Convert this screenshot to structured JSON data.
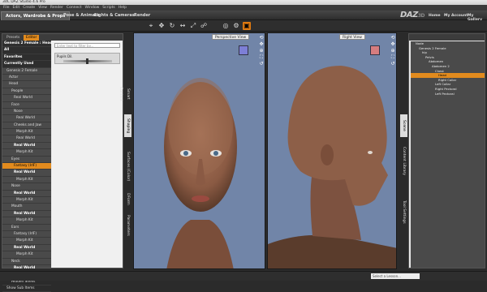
{
  "window": {
    "title": "3dC DAZ Studio 4.6 Pro"
  },
  "menu": [
    "File",
    "Edit",
    "Create",
    "View",
    "Render",
    "Connect",
    "Window",
    "Scripts",
    "Help"
  ],
  "main_tabs": [
    "Actors, Wardrobe & Props",
    "Pose & Animate",
    "Lights & Cameras",
    "Render"
  ],
  "brand": {
    "logo": "DAZ",
    "logo_suffix": "3D"
  },
  "top_links": [
    "Home",
    "My Account",
    "My Gallery"
  ],
  "left_panel": {
    "tabs": [
      "Presets",
      "Editor"
    ],
    "tree": [
      {
        "label": "Genesis 2 Female : Head",
        "style": "hdr"
      },
      {
        "label": "All",
        "style": "hdr"
      },
      {
        "label": "Favorites",
        "style": "hdr"
      },
      {
        "label": "Currently Used",
        "style": "hdr"
      },
      {
        "label": "Genesis 2 Female"
      },
      {
        "label": "Actor"
      },
      {
        "label": "Head"
      },
      {
        "label": "People"
      },
      {
        "label": "Real World"
      },
      {
        "label": "Face"
      },
      {
        "label": "Nose"
      },
      {
        "label": "Real World"
      },
      {
        "label": "Cheeks and Jaw"
      },
      {
        "label": "Morph Kit"
      },
      {
        "label": "Real World"
      },
      {
        "label": "Real World",
        "style": "white"
      },
      {
        "label": "Morph Kit"
      },
      {
        "label": "Eyes"
      },
      {
        "label": "Fantasy (IrIF)",
        "style": "sel"
      },
      {
        "label": "Real World",
        "style": "white"
      },
      {
        "label": "Morph Kit"
      },
      {
        "label": "Nose"
      },
      {
        "label": "Real World",
        "style": "white"
      },
      {
        "label": "Morph Kit"
      },
      {
        "label": "Mouth"
      },
      {
        "label": "Real World",
        "style": "white"
      },
      {
        "label": "Morph Kit"
      },
      {
        "label": "Ears"
      },
      {
        "label": "Fantasy (IrIF)"
      },
      {
        "label": "Morph Kit"
      },
      {
        "label": "Real World",
        "style": "white"
      },
      {
        "label": "Morph Kit"
      },
      {
        "label": "Neck"
      },
      {
        "label": "Real World",
        "style": "white"
      },
      {
        "label": "Morph Kit"
      },
      {
        "label": "Hidden Shells"
      },
      {
        "label": "Show Sub Items"
      }
    ],
    "filter_placeholder": "Enter text to filter by...",
    "slider": {
      "label": "Pupils Dil.",
      "value_fraction": 0.47
    }
  },
  "left_vtabs": [
    "Posing",
    "Shaping",
    "Surfaces (Color)",
    "DForm",
    "Parameters",
    "Smart Content"
  ],
  "viewports": [
    {
      "label": "Perspective View",
      "cube_color": "#7d7fd6"
    },
    {
      "label": "Right View",
      "cube_color": "#d67d7f"
    }
  ],
  "right_vtabs": [
    "Scene",
    "Content Library",
    "Tool Settings"
  ],
  "scene_tree": [
    "Node",
    "Genesis 2 Female",
    "hip",
    "Pelvis",
    "Abdomen",
    "Abdomen 2",
    "Chest",
    "Head",
    "Right Collar",
    "Left Collar",
    "Right Pectoral",
    "Left Pectoral"
  ],
  "scene_selected": "Head",
  "status": {
    "lesson_placeholder": "Select a Lesson..."
  }
}
